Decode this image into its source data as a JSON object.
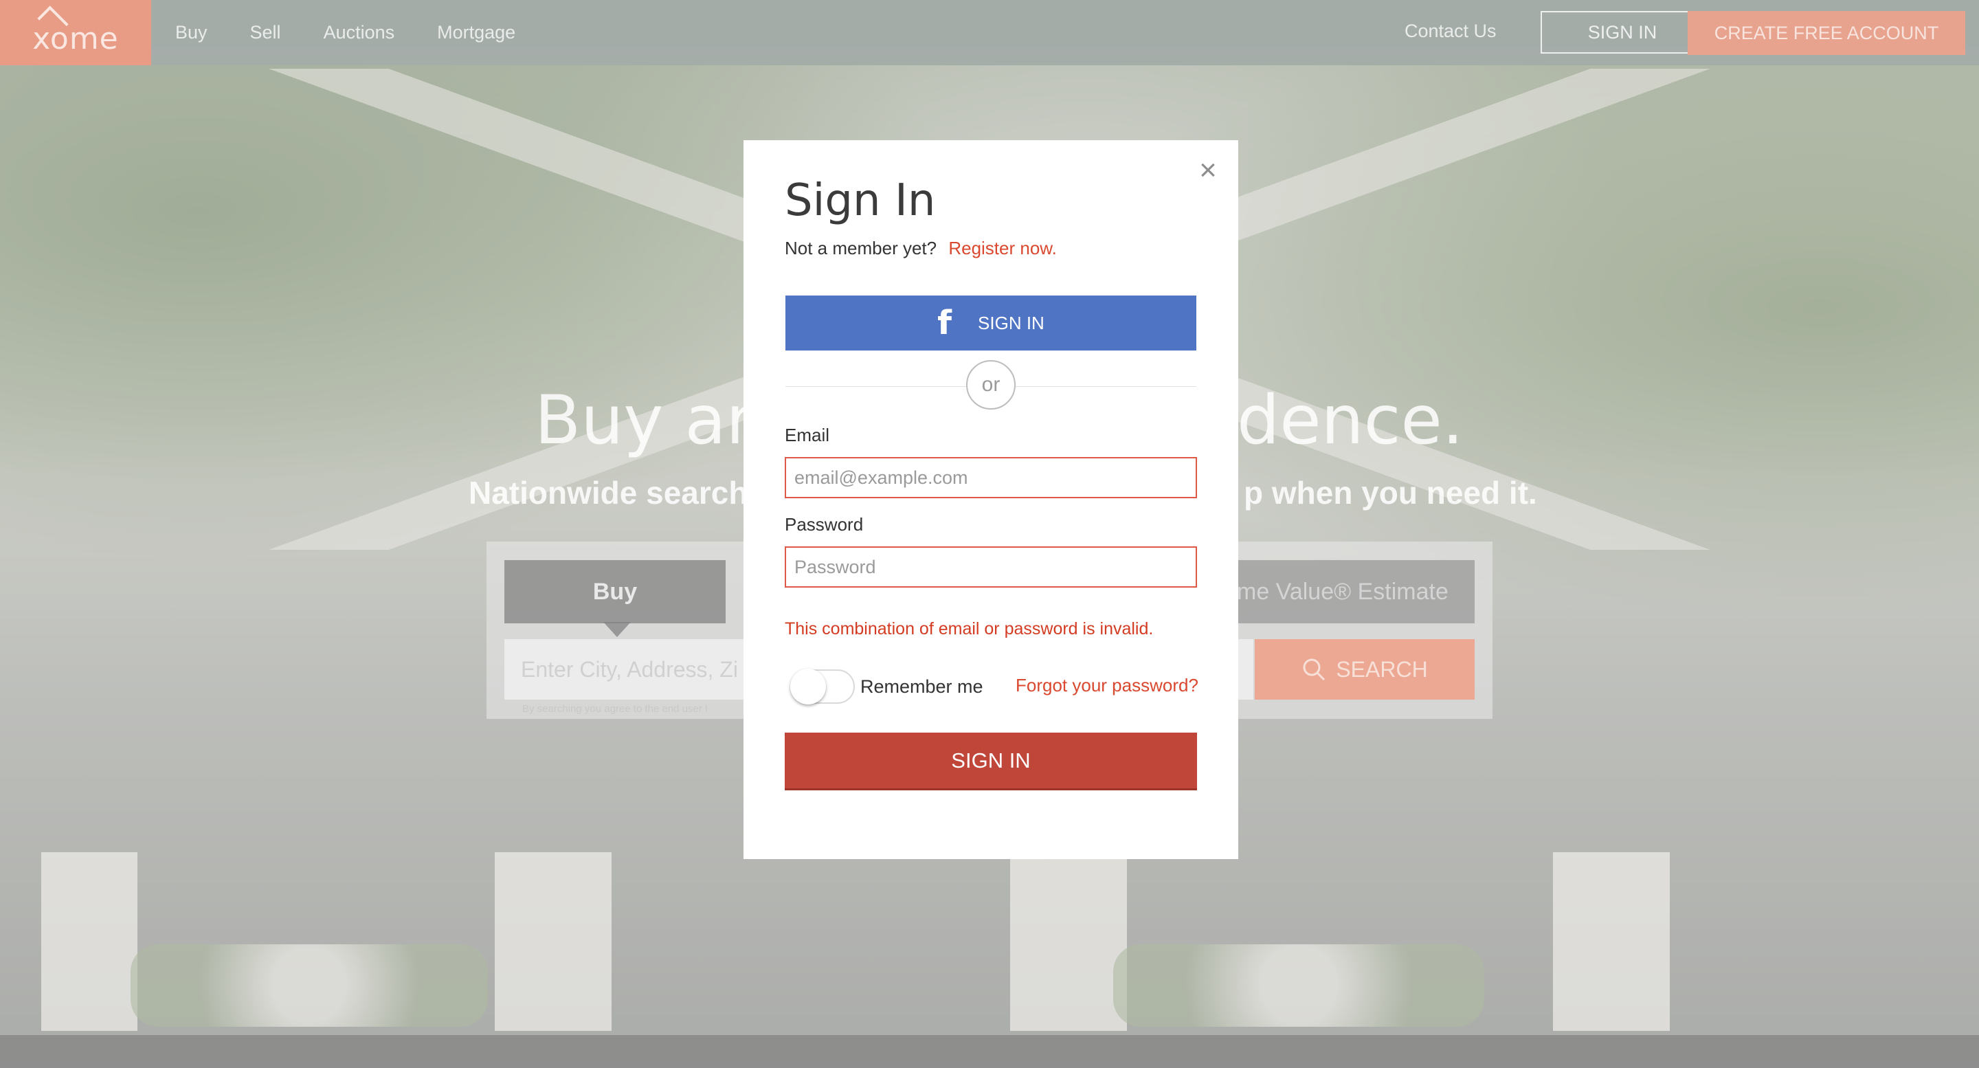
{
  "nav": {
    "logo": "xome",
    "links": [
      "Buy",
      "Sell",
      "Auctions",
      "Mortgage"
    ],
    "contact": "Contact Us",
    "signin": "SIGN IN",
    "create_account": "CREATE FREE ACCOUNT"
  },
  "hero": {
    "title_left": "Buy an",
    "title_right": "dence.",
    "subtitle_left": "Nationwide search",
    "subtitle_right": "p when you need it.",
    "tab_buy": "Buy",
    "tab_estimate": "me Value® Estimate",
    "search_placeholder": "Enter City, Address, Zi",
    "search_button": "SEARCH",
    "search_note": "By searching you agree to the end user l"
  },
  "modal": {
    "title": "Sign In",
    "not_member": "Not a member yet?",
    "register": "Register now.",
    "facebook_signin": "SIGN IN",
    "facebook_icon": "f",
    "or": "or",
    "email_label": "Email",
    "email_placeholder": "email@example.com",
    "password_label": "Password",
    "password_placeholder": "Password",
    "error": "This combination of email or password is invalid.",
    "remember_me": "Remember me",
    "forgot_password": "Forgot your password?",
    "signin_button": "SIGN IN",
    "close": "×"
  },
  "colors": {
    "accent": "#d9482f",
    "facebook": "#4f74c3",
    "signin_button": "#c0463a",
    "logo_bg": "#e89c86"
  }
}
